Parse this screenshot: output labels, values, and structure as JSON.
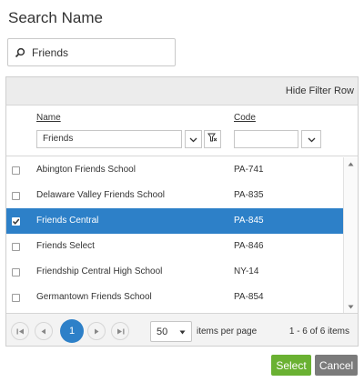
{
  "dialog": {
    "title": "Search Name"
  },
  "search": {
    "value": "Friends",
    "icon": "search-icon"
  },
  "grid": {
    "toolbar": {
      "hide_filter_row": "Hide Filter Row"
    },
    "columns": {
      "name": "Name",
      "code": "Code"
    },
    "filters": {
      "name_value": "Friends",
      "code_value": ""
    },
    "rows": [
      {
        "name": "Abington Friends School",
        "code": "PA-741",
        "checked": false,
        "selected": false
      },
      {
        "name": "Delaware Valley Friends School",
        "code": "PA-835",
        "checked": false,
        "selected": false
      },
      {
        "name": "Friends Central",
        "code": "PA-845",
        "checked": true,
        "selected": true
      },
      {
        "name": "Friends Select",
        "code": "PA-846",
        "checked": false,
        "selected": false
      },
      {
        "name": "Friendship Central High School",
        "code": "NY-14",
        "checked": false,
        "selected": false
      },
      {
        "name": "Germantown Friends School",
        "code": "PA-854",
        "checked": false,
        "selected": false
      }
    ],
    "pager": {
      "current_page": "1",
      "page_size": "50",
      "items_per_page": "items per page",
      "info": "1 - 6 of 6 items"
    }
  },
  "buttons": {
    "select": "Select",
    "cancel": "Cancel"
  },
  "colors": {
    "accent": "#2d80c8",
    "select_button": "#6ab132",
    "cancel_button": "#7b7b7b"
  }
}
